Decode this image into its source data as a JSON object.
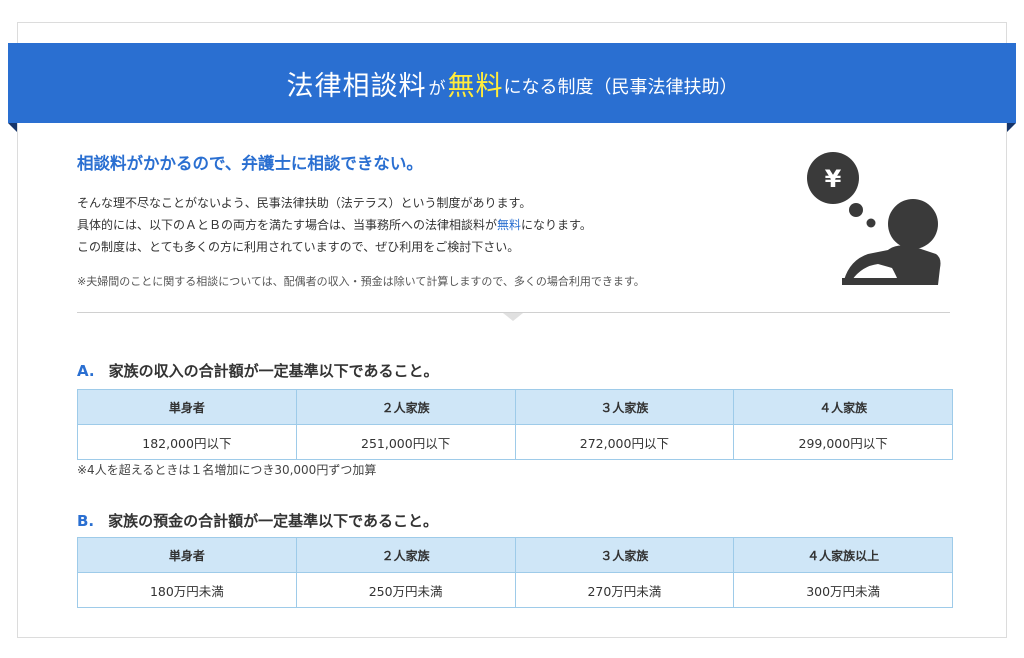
{
  "banner": {
    "part1": "法律相談料",
    "part2": "が",
    "part3": "無料",
    "part4": "になる制度（民事法律扶助）"
  },
  "intro": {
    "title": "相談料がかかるので、弁護士に相談できない。",
    "line1": "そんな理不尽なことがないよう、民事法律扶助（法テラス）という制度があります。",
    "line2_pre": "具体的には、以下のＡとＢの両方を満たす場合は、当事務所への法律相談料が",
    "line2_hl": "無料",
    "line2_post": "になります。",
    "line3": "この制度は、とても多くの方に利用されていますので、ぜひ利用をご検討下さい。",
    "note": "※夫婦間のことに関する相談については、配偶者の収入・預金は除いて計算しますので、多くの場合利用できます。"
  },
  "illustration": {
    "icon": "yen-worried-person-icon",
    "symbol": "¥",
    "color": "#3a3a3a"
  },
  "section_a": {
    "letter": "A.",
    "title": "家族の収入の合計額が一定基準以下であること。",
    "headers": [
      "単身者",
      "２人家族",
      "３人家族",
      "４人家族"
    ],
    "values": [
      "182,000円以下",
      "251,000円以下",
      "272,000円以下",
      "299,000円以下"
    ],
    "note": "※4人を超えるときは１名増加につき30,000円ずつ加算"
  },
  "section_b": {
    "letter": "B.",
    "title": "家族の預金の合計額が一定基準以下であること。",
    "headers": [
      "単身者",
      "２人家族",
      "３人家族",
      "４人家族以上"
    ],
    "values": [
      "180万円未満",
      "250万円未満",
      "270万円未満",
      "300万円未満"
    ]
  },
  "colors": {
    "accent": "#2a6fd1",
    "highlight": "#ffeb3b",
    "table_header": "#cfe6f7",
    "table_border": "#9ecbe9"
  }
}
